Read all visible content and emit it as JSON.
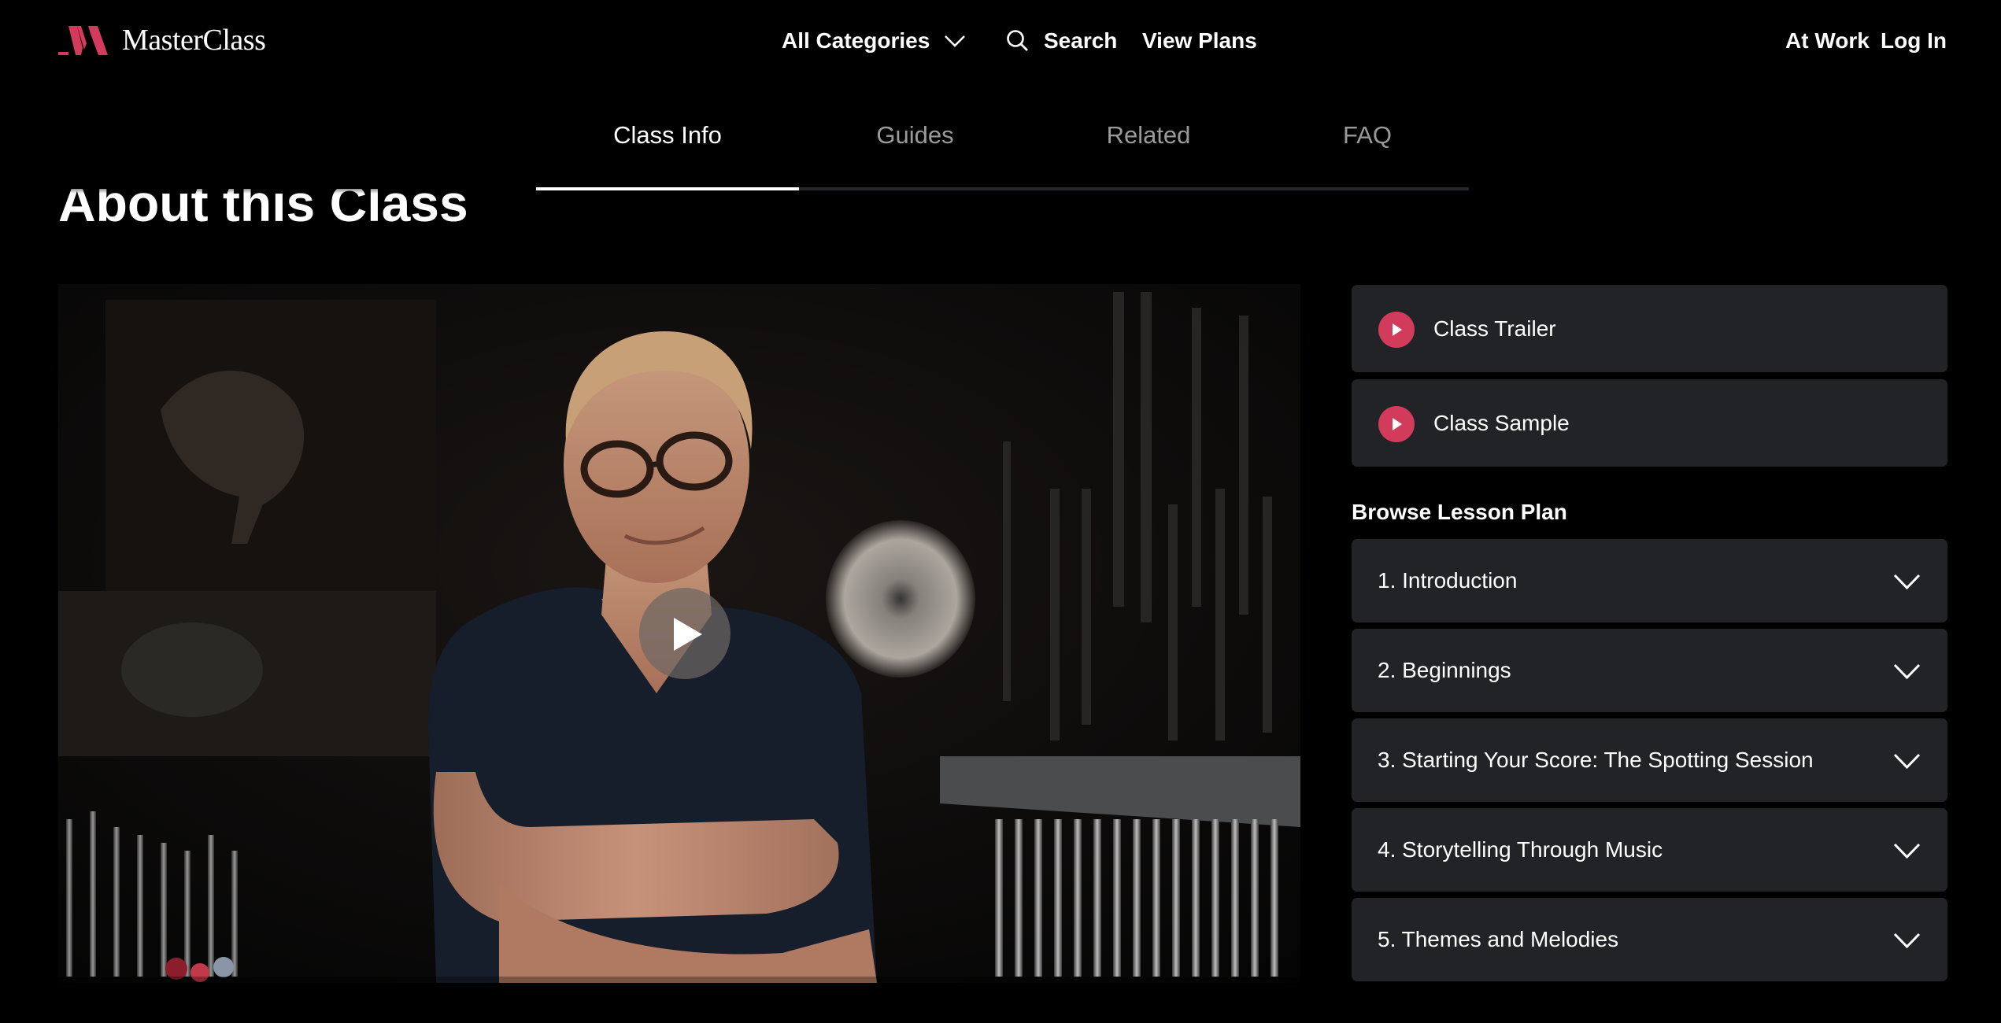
{
  "header": {
    "brand": "MasterClass",
    "brand_color": "#d23b5b",
    "nav": {
      "categories_label": "All Categories",
      "categories_icon": "chevron-down-icon",
      "search_icon": "search-icon",
      "search_label": "Search",
      "plans_label": "View Plans",
      "at_work_label": "At Work",
      "login_label": "Log In"
    }
  },
  "tabs": [
    {
      "label": "Class Info",
      "active": true
    },
    {
      "label": "Guides",
      "active": false
    },
    {
      "label": "Related",
      "active": false
    },
    {
      "label": "FAQ",
      "active": false
    }
  ],
  "main": {
    "heading": "About this Class",
    "video": {
      "play_icon": "play-icon"
    }
  },
  "sidebar": {
    "media": [
      {
        "label": "Class Trailer",
        "icon": "play-circle-icon"
      },
      {
        "label": "Class Sample",
        "icon": "play-circle-icon"
      }
    ],
    "browse_title": "Browse Lesson Plan",
    "lessons": [
      {
        "label": "1. Introduction"
      },
      {
        "label": "2. Beginnings"
      },
      {
        "label": "3. Starting Your Score: The Spotting Session"
      },
      {
        "label": "4. Storytelling Through Music"
      },
      {
        "label": "5. Themes and Melodies"
      }
    ]
  },
  "colors": {
    "background": "#000000",
    "card": "#222327",
    "accent": "#d23b5b",
    "tab_inactive": "#9a9a9a"
  }
}
